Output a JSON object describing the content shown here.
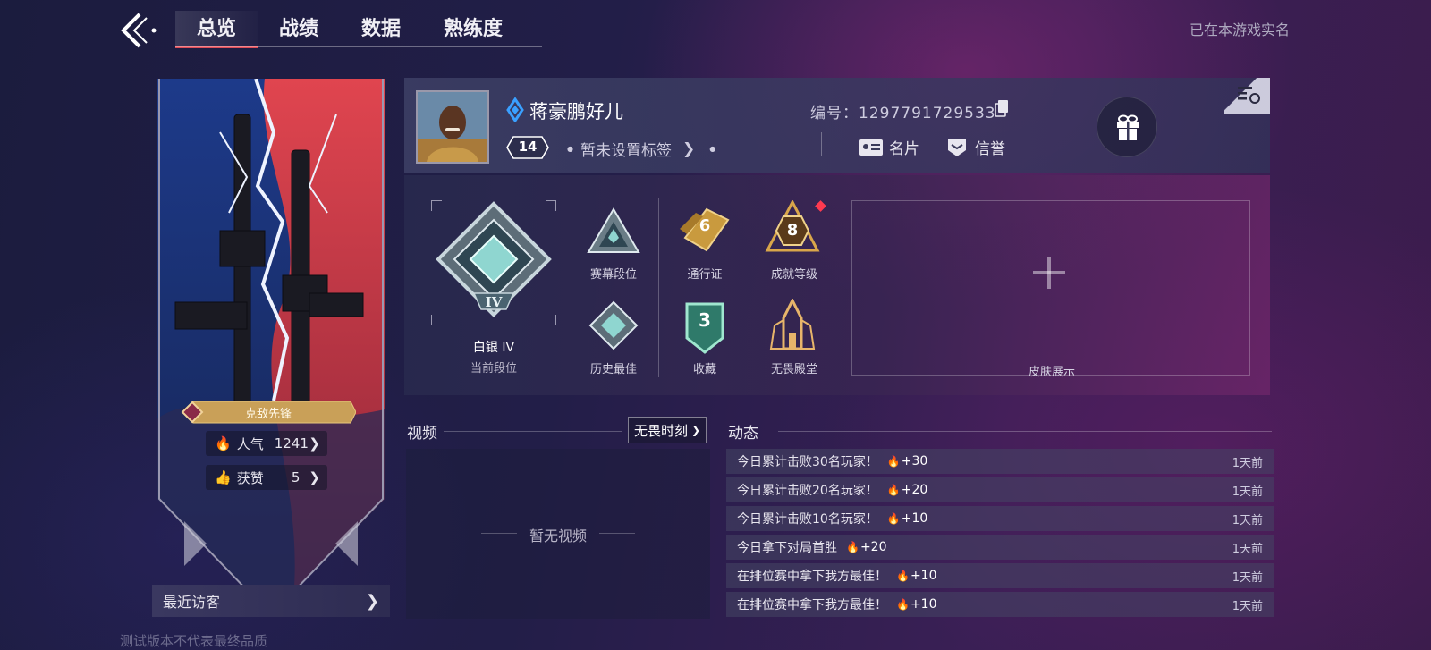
{
  "nav": {
    "tabs": [
      {
        "label": "总览",
        "active": true
      },
      {
        "label": "战绩",
        "active": false
      },
      {
        "label": "数据",
        "active": false
      },
      {
        "label": "熟练度",
        "active": false
      }
    ],
    "realname_status": "已在本游戏实名"
  },
  "banner": {
    "title_badge": "克敌先锋",
    "popularity_label": "人气",
    "popularity_value": "1241",
    "likes_label": "获赞",
    "likes_value": "5",
    "recent_visitors": "最近访客"
  },
  "profile": {
    "name": "蒋豪鹏好儿",
    "level": "14",
    "tag_placeholder": "暂未设置标签",
    "id_label": "编号：",
    "id_value": "1297791729533",
    "namecard_label": "名片",
    "credit_label": "信誉"
  },
  "stats": {
    "current_rank_name": "白银 IV",
    "current_rank_label": "当前段位",
    "rank_numeral": "IV",
    "season_rank_label": "赛幕段位",
    "best_rank_label": "历史最佳",
    "battlepass_value": "6",
    "battlepass_label": "通行证",
    "achievement_value": "8",
    "achievement_label": "成就等级",
    "collection_value": "3",
    "collection_label": "收藏",
    "hall_label": "无畏殿堂",
    "skin_label": "皮肤展示"
  },
  "video": {
    "title": "视频",
    "link_label": "无畏时刻",
    "empty_text": "暂无视频"
  },
  "feed": {
    "title": "动态",
    "items": [
      {
        "text": "今日累计击败30名玩家！",
        "points": "+30",
        "time": "1天前"
      },
      {
        "text": "今日累计击败20名玩家！",
        "points": "+20",
        "time": "1天前"
      },
      {
        "text": "今日累计击败10名玩家！",
        "points": "+10",
        "time": "1天前"
      },
      {
        "text": "今日拿下对局首胜",
        "points": "+20",
        "time": "1天前"
      },
      {
        "text": "在排位赛中拿下我方最佳！",
        "points": "+10",
        "time": "1天前"
      },
      {
        "text": "在排位赛中拿下我方最佳！",
        "points": "+10",
        "time": "1天前"
      }
    ]
  },
  "footer": {
    "watermark": "测试版本不代表最终品质"
  },
  "colors": {
    "accent_red": "#e34c56",
    "gold": "#d9a64a",
    "silver_teal": "#8fd6d0"
  }
}
